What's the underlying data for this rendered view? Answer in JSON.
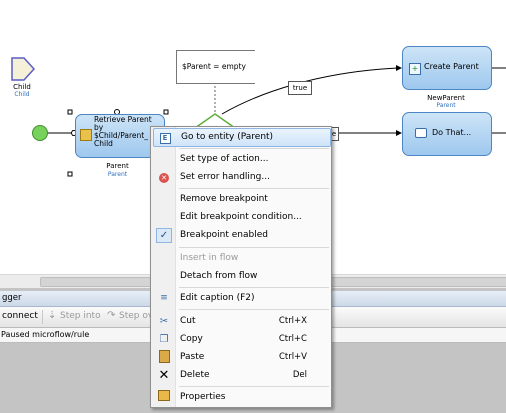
{
  "canvas": {
    "child_entity": {
      "label": "Child",
      "sublabel": "Child"
    },
    "retrieve": {
      "title": "Retrieve Parent",
      "line2": "by",
      "line3": "$Child/Parent_",
      "line4": "Child",
      "out_label": "Parent",
      "out_sublabel": "Parent"
    },
    "annotation": "$Parent = empty",
    "true_label": "true",
    "partial_label": "e",
    "create": {
      "label": "Create Parent",
      "out_label": "NewParent",
      "out_sublabel": "Parent"
    },
    "do_that": {
      "label": "Do That..."
    }
  },
  "debugger": {
    "title": "gger",
    "toolbar": {
      "connect": "connect",
      "step_into": "Step into",
      "step_over": "Step ov"
    },
    "status": "Paused microflow/rule"
  },
  "menu": {
    "items": [
      {
        "label": "Go to entity (Parent)",
        "icon": "entity-icon",
        "highlighted": true
      },
      {
        "label": "Set type of action..."
      },
      {
        "label": "Set error handling...",
        "icon": "error-icon"
      },
      {
        "label": "Remove breakpoint"
      },
      {
        "label": "Edit breakpoint condition..."
      },
      {
        "label": "Breakpoint enabled",
        "icon": "checkmark-icon",
        "checked": true
      },
      {
        "label": "Insert in flow",
        "disabled": true
      },
      {
        "label": "Detach from flow"
      },
      {
        "label": "Edit caption (F2)",
        "icon": "caption-icon"
      },
      {
        "label": "Cut",
        "shortcut": "Ctrl+X",
        "icon": "scissors-icon"
      },
      {
        "label": "Copy",
        "shortcut": "Ctrl+C",
        "icon": "copy-icon"
      },
      {
        "label": "Paste",
        "shortcut": "Ctrl+V",
        "icon": "paste-icon"
      },
      {
        "label": "Delete",
        "shortcut": "Del",
        "icon": "delete-icon"
      },
      {
        "label": "Properties",
        "icon": "properties-icon"
      }
    ]
  },
  "colors": {
    "accent": "#4d86c4",
    "start_event": "#77d15c",
    "decision": "#5fae3a",
    "error": "#d9534f"
  }
}
